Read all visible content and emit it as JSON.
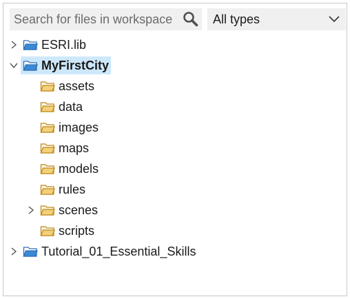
{
  "search": {
    "placeholder": "Search for files in workspace",
    "value": ""
  },
  "filter": {
    "selected": "All types"
  },
  "icons": {
    "search": "search-icon",
    "dropdown": "chevron-down-icon",
    "expand": "chevron-right-icon",
    "collapse": "chevron-down-icon",
    "project_folder": "blue-folder-icon",
    "folder": "yellow-folder-icon"
  },
  "colors": {
    "project_folder": "#3a8ad6",
    "folder": "#e8b84a",
    "selection": "#cde8fb"
  },
  "tree": {
    "projects": [
      {
        "label": "ESRI.lib",
        "expanded": false
      },
      {
        "label": "MyFirstCity",
        "expanded": true,
        "selected": true,
        "children": [
          {
            "label": "assets"
          },
          {
            "label": "data"
          },
          {
            "label": "images"
          },
          {
            "label": "maps"
          },
          {
            "label": "models"
          },
          {
            "label": "rules"
          },
          {
            "label": "scenes",
            "expandable": true
          },
          {
            "label": "scripts"
          }
        ]
      },
      {
        "label": "Tutorial_01_Essential_Skills",
        "expanded": false
      }
    ]
  }
}
